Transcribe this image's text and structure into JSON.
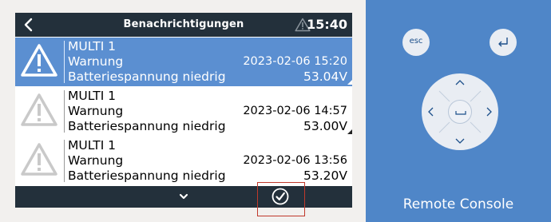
{
  "header": {
    "title": "Benachrichtigungen",
    "time": "15:40",
    "back_icon": "chevron-left-icon",
    "alert_icon": "warning-triangle-icon"
  },
  "notifications": [
    {
      "device": "MULTI 1",
      "type": "Warnung",
      "datetime": "2023-02-06 15:20",
      "message": "Batteriespannung niedrig",
      "value": "53.04V",
      "selected": true
    },
    {
      "device": "MULTI 1",
      "type": "Warnung",
      "datetime": "2023-02-06 14:57",
      "message": "Batteriespannung niedrig",
      "value": "53.00V",
      "selected": false
    },
    {
      "device": "MULTI 1",
      "type": "Warnung",
      "datetime": "2023-02-06 13:56",
      "message": "Batteriespannung niedrig",
      "value": "53.20V",
      "selected": false
    }
  ],
  "footer": {
    "scroll_icon": "chevron-down-icon",
    "ack_icon": "check-circle-icon"
  },
  "remote": {
    "esc_label": "esc",
    "enter_icon": "enter-icon",
    "brand_label": "Remote Console"
  },
  "colors": {
    "bar": "#23303b",
    "selected_row": "#5b8fd1",
    "panel": "#4f86c8",
    "highlight_box": "#c0392b"
  }
}
